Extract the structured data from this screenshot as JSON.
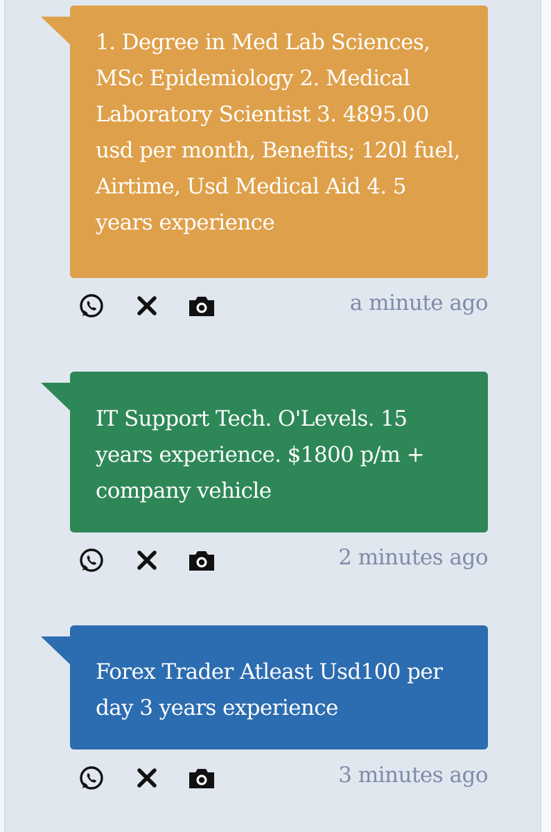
{
  "colors": {
    "background": "#e1e7ef",
    "post_1": "#dea04a",
    "post_2": "#2e8757",
    "post_3": "#2c6cb0",
    "timestamp": "#7e8ca8",
    "icon": "#111111"
  },
  "posts": [
    {
      "text": "1. Degree in Med Lab Sciences, MSc Epidemiology 2. Medical Laboratory Scientist 3. 4895.00 usd per month, Benefits; 120l fuel, Airtime, Usd Medical Aid 4. 5 years experience",
      "time": "a minute ago",
      "icons": [
        "whatsapp-icon",
        "close-icon",
        "camera-icon"
      ]
    },
    {
      "text": "IT Support Tech. O'Levels. 15 years experience. $1800 p/m + company vehicle",
      "time": "2 minutes ago",
      "icons": [
        "whatsapp-icon",
        "close-icon",
        "camera-icon"
      ]
    },
    {
      "text": "Forex Trader Atleast Usd100 per day 3 years experience",
      "time": "3 minutes ago",
      "icons": [
        "whatsapp-icon",
        "close-icon",
        "camera-icon"
      ]
    }
  ]
}
